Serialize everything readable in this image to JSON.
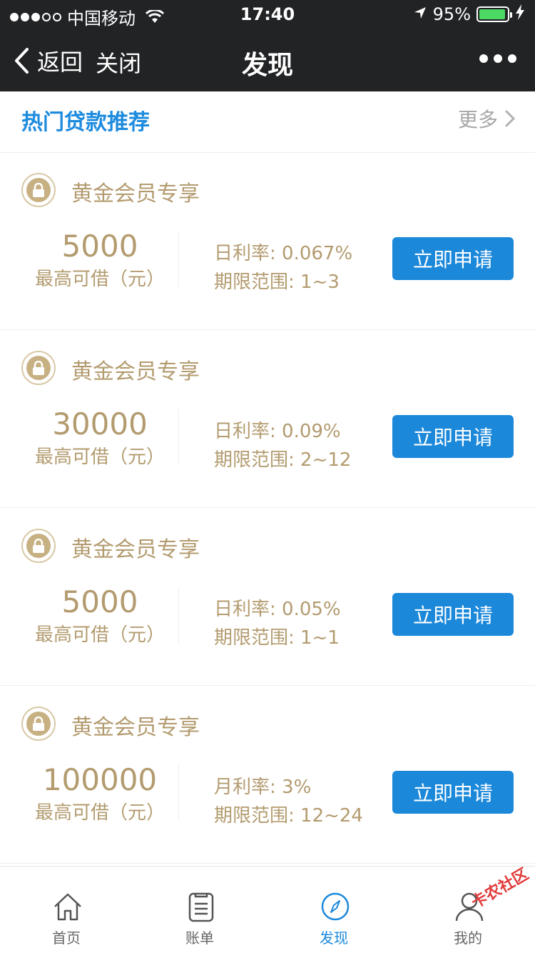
{
  "status": {
    "carrier": "中国移动",
    "time": "17:40",
    "battery": "95%"
  },
  "nav": {
    "back_label": "返回",
    "close_label": "关闭",
    "title": "发现"
  },
  "section": {
    "title": "热门贷款推荐",
    "more_label": "更多"
  },
  "cards": [
    {
      "vip_label": "黄金会员专享",
      "amount": "5000",
      "amount_label": "最高可借（元）",
      "rate": "日利率: 0.067%",
      "term": "期限范围: 1~3",
      "apply_label": "立即申请"
    },
    {
      "vip_label": "黄金会员专享",
      "amount": "30000",
      "amount_label": "最高可借（元）",
      "rate": "日利率: 0.09%",
      "term": "期限范围: 2~12",
      "apply_label": "立即申请"
    },
    {
      "vip_label": "黄金会员专享",
      "amount": "5000",
      "amount_label": "最高可借（元）",
      "rate": "日利率: 0.05%",
      "term": "期限范围: 1~1",
      "apply_label": "立即申请"
    },
    {
      "vip_label": "黄金会员专享",
      "amount": "100000",
      "amount_label": "最高可借（元）",
      "rate": "月利率: 3%",
      "term": "期限范围: 12~24",
      "apply_label": "立即申请"
    }
  ],
  "tabs": [
    {
      "label": "首页",
      "icon": "home-icon"
    },
    {
      "label": "账单",
      "icon": "bill-icon"
    },
    {
      "label": "发现",
      "icon": "compass-icon",
      "active": true
    },
    {
      "label": "我的",
      "icon": "user-icon"
    }
  ],
  "watermark": "卡农社区",
  "colors": {
    "nav_bg": "#222325",
    "accent_blue": "#1b88da",
    "gold": "#b39b6f",
    "battery_green": "#4cd964"
  }
}
